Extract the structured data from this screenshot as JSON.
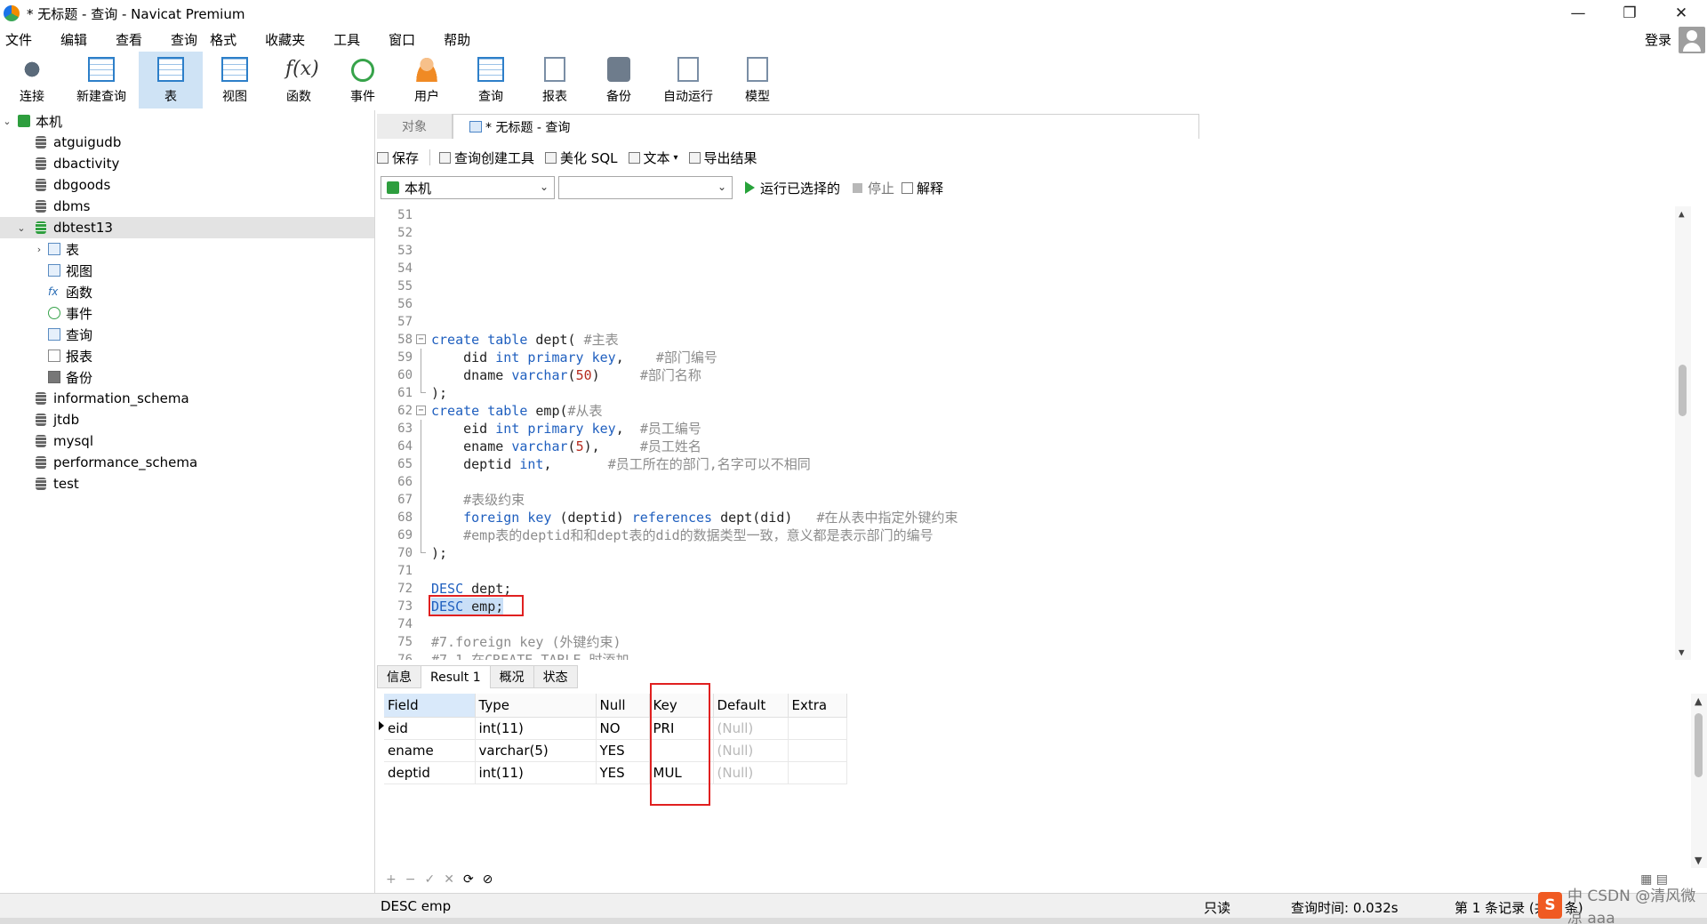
{
  "window": {
    "title": "* 无标题 - 查询 - Navicat Premium",
    "controls": [
      "—",
      "❐",
      "✕"
    ]
  },
  "menu": {
    "items": [
      "文件",
      "编辑",
      "查看",
      "查询",
      "格式",
      "收藏夹",
      "工具",
      "窗口",
      "帮助"
    ],
    "login": "登录"
  },
  "toolbar": {
    "buttons": [
      {
        "label": "连接",
        "icon": "plug-icon"
      },
      {
        "label": "新建查询",
        "icon": "new-query-icon"
      },
      {
        "label": "表",
        "icon": "table-icon",
        "active": true
      },
      {
        "label": "视图",
        "icon": "view-icon"
      },
      {
        "label": "函数",
        "icon": "function-icon"
      },
      {
        "label": "事件",
        "icon": "event-clock-icon"
      },
      {
        "label": "用户",
        "icon": "user-icon"
      },
      {
        "label": "查询",
        "icon": "query-icon"
      },
      {
        "label": "报表",
        "icon": "report-icon"
      },
      {
        "label": "备份",
        "icon": "backup-icon"
      },
      {
        "label": "自动运行",
        "icon": "auto-run-icon"
      },
      {
        "label": "模型",
        "icon": "model-icon"
      }
    ]
  },
  "tree": {
    "connection": "本机",
    "databases": [
      "atguigudb",
      "dbactivity",
      "dbgoods",
      "dbms",
      "dbtest13",
      "information_schema",
      "jtdb",
      "mysql",
      "performance_schema",
      "test"
    ],
    "selected": "dbtest13",
    "children": [
      "表",
      "视图",
      "函数",
      "事件",
      "查询",
      "报表",
      "备份"
    ]
  },
  "tabs": {
    "objects": "对象",
    "query": "* 无标题 - 查询"
  },
  "query_toolbar": {
    "save": "保存",
    "builder": "查询创建工具",
    "beautify": "美化 SQL",
    "text": "文本",
    "export": "导出结果",
    "connection": "本机",
    "database": "",
    "run_selected": "运行已选择的",
    "stop": "停止",
    "explain": "解释"
  },
  "editor": {
    "lines": [
      {
        "n": "51",
        "t": ""
      },
      {
        "n": "52",
        "t": ""
      },
      {
        "n": "53",
        "t": ""
      },
      {
        "n": "54",
        "t": ""
      },
      {
        "n": "55",
        "t": ""
      },
      {
        "n": "56",
        "t": ""
      },
      {
        "n": "57",
        "t": ""
      },
      {
        "n": "58",
        "t": "create table dept( #主表"
      },
      {
        "n": "59",
        "t": "    did int primary key,    #部门编号"
      },
      {
        "n": "60",
        "t": "    dname varchar(50)     #部门名称"
      },
      {
        "n": "61",
        "t": ");"
      },
      {
        "n": "62",
        "t": "create table emp(#从表"
      },
      {
        "n": "63",
        "t": "    eid int primary key,  #员工编号"
      },
      {
        "n": "64",
        "t": "    ename varchar(5),     #员工姓名"
      },
      {
        "n": "65",
        "t": "    deptid int,       #员工所在的部门,名字可以不相同"
      },
      {
        "n": "66",
        "t": ""
      },
      {
        "n": "67",
        "t": "    #表级约束"
      },
      {
        "n": "68",
        "t": "    foreign key (deptid) references dept(did)   #在从表中指定外键约束"
      },
      {
        "n": "69",
        "t": "    #emp表的deptid和和dept表的did的数据类型一致，意义都是表示部门的编号"
      },
      {
        "n": "70",
        "t": ");"
      },
      {
        "n": "71",
        "t": ""
      },
      {
        "n": "72",
        "t": "DESC dept;"
      },
      {
        "n": "73",
        "t": "DESC emp;"
      },
      {
        "n": "74",
        "t": ""
      },
      {
        "n": "75",
        "t": "#7.foreign key (外键约束)"
      },
      {
        "n": "76",
        "t": "#7.1 在CREATE TABLE 时添加"
      }
    ]
  },
  "results": {
    "tabs": [
      "信息",
      "Result 1",
      "概况",
      "状态"
    ],
    "columns": [
      "Field",
      "Type",
      "Null",
      "Key",
      "Default",
      "Extra"
    ],
    "rows": [
      [
        "eid",
        "int(11)",
        "NO",
        "PRI",
        "(Null)",
        ""
      ],
      [
        "ename",
        "varchar(5)",
        "YES",
        "",
        "(Null)",
        ""
      ],
      [
        "deptid",
        "int(11)",
        "YES",
        "MUL",
        "(Null)",
        ""
      ]
    ],
    "bottom_controls": [
      "+",
      "−",
      "✓",
      "✕",
      "⟳",
      "⊘"
    ]
  },
  "status": {
    "sql": "DESC emp",
    "readonly": "只读",
    "query_time": "查询时间: 0.032s",
    "record": "第 1 条记录 (共 3 条)"
  },
  "watermark": {
    "logo": "S",
    "text": "中 CSDN @清风微凉 aaa"
  }
}
